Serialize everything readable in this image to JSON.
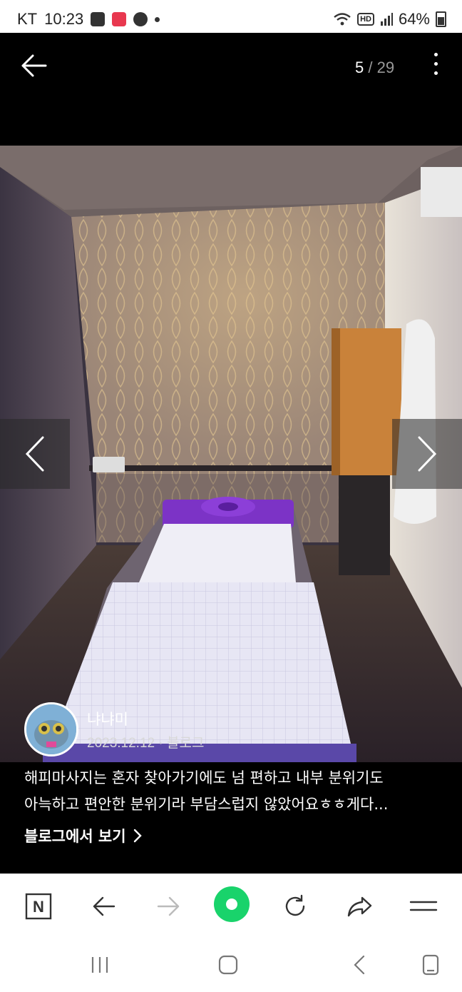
{
  "status_bar": {
    "carrier": "KT",
    "time": "10:23",
    "battery": "64%"
  },
  "viewer": {
    "current_index": "5",
    "separator": "/",
    "total": "29"
  },
  "post": {
    "author": "냐냐미",
    "date": "2023.12.12",
    "meta_sep": "·",
    "source": "블로그",
    "caption_line1": "해피마사지는 혼자 찾아가기에도 넘 편하고 내부 분위기도",
    "caption_line2": "아늑하고 편안한 분위기라 부담스럽지 않았어요ㅎㅎ게다...",
    "blog_link": "블로그에서 보기"
  },
  "toolbar": {
    "home_letter": "N"
  },
  "colors": {
    "accent_green": "#19d36b",
    "background": "#000000"
  }
}
